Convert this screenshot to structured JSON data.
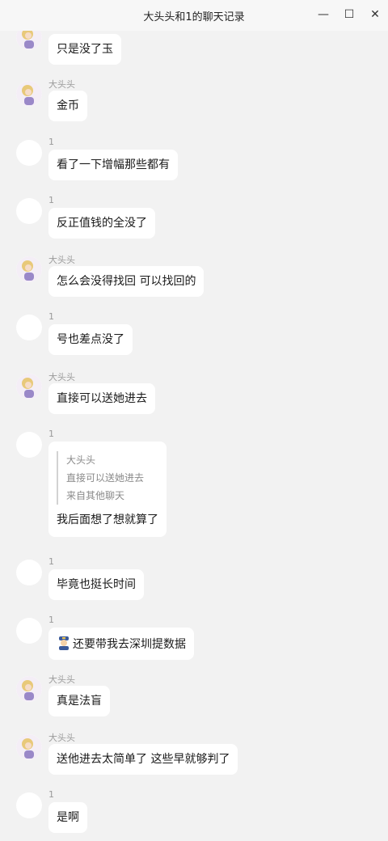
{
  "window": {
    "title": "大头头和1的聊天记录",
    "minimize_glyph": "—",
    "maximize_glyph": "☐",
    "close_glyph": "✕"
  },
  "colors": {
    "background": "#f2f2f2",
    "bubble": "#ffffff",
    "name": "#9a9a9a"
  },
  "messages": [
    {
      "sender": "",
      "avatar": "girl-avatar-icon",
      "text": "只是没了玉"
    },
    {
      "sender": "大头头",
      "avatar": "girl-avatar-icon",
      "text": "金币"
    },
    {
      "sender": "1",
      "avatar": "blank-avatar",
      "text": "看了一下增幅那些都有"
    },
    {
      "sender": "1",
      "avatar": "blank-avatar",
      "text": "反正值钱的全没了"
    },
    {
      "sender": "大头头",
      "avatar": "girl-avatar-icon",
      "text": "怎么会没得找回  可以找回的"
    },
    {
      "sender": "1",
      "avatar": "blank-avatar",
      "text": "号也差点没了"
    },
    {
      "sender": "大头头",
      "avatar": "girl-avatar-icon",
      "text": "直接可以送她进去"
    },
    {
      "sender": "1",
      "avatar": "blank-avatar",
      "text": "我后面想了想就算了",
      "quote": {
        "name": "大头头",
        "text": "直接可以送她进去",
        "source": "来自其他聊天"
      }
    },
    {
      "sender": "1",
      "avatar": "blank-avatar",
      "text": "毕竟也挺长时间"
    },
    {
      "sender": "1",
      "avatar": "blank-avatar",
      "text": "还要带我去深圳提数据",
      "icon": "police-officer-emoji-icon"
    },
    {
      "sender": "大头头",
      "avatar": "girl-avatar-icon",
      "text": "真是法盲"
    },
    {
      "sender": "大头头",
      "avatar": "girl-avatar-icon",
      "text": "送他进去太简单了 这些早就够判了"
    },
    {
      "sender": "1",
      "avatar": "blank-avatar",
      "text": "是啊"
    }
  ]
}
